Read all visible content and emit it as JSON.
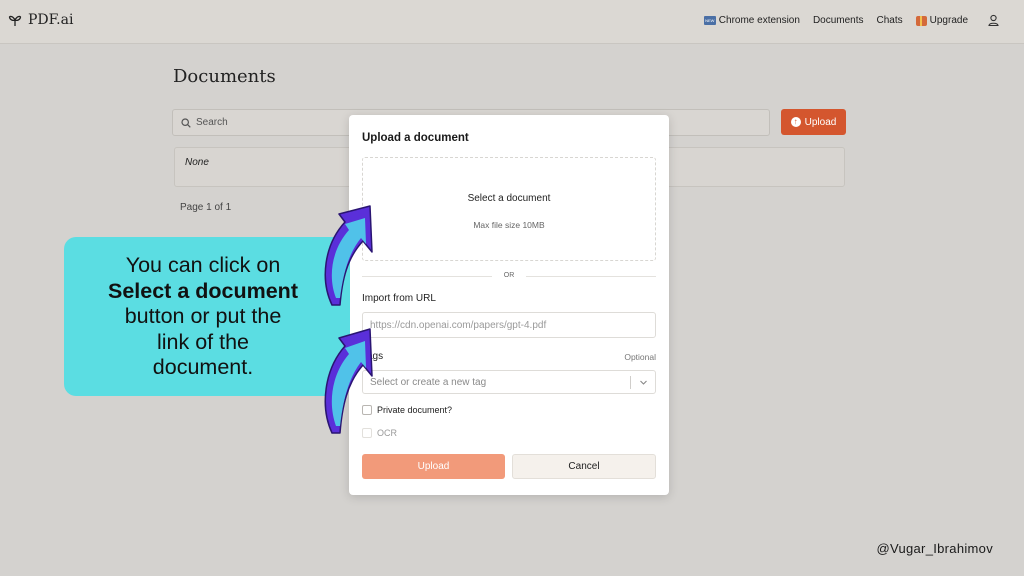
{
  "nav": {
    "brand": "PDF.ai",
    "badge_new": "NEW",
    "links": {
      "chrome_extension": "Chrome extension",
      "documents": "Documents",
      "chats": "Chats",
      "upgrade": "Upgrade"
    }
  },
  "page": {
    "title": "Documents",
    "search_placeholder": "Search",
    "upload_button": "Upload",
    "empty_row": "None",
    "pager": "Page 1 of 1"
  },
  "modal": {
    "title": "Upload a document",
    "dropzone_title": "Select a document",
    "dropzone_sub": "Max file size 10MB",
    "or": "OR",
    "import_label": "Import from URL",
    "url_placeholder": "https://cdn.openai.com/papers/gpt-4.pdf",
    "tags_label": "Tags",
    "optional": "Optional",
    "tag_placeholder": "Select or create a new tag",
    "private_label": "Private document?",
    "ocr_label": "OCR",
    "upload_button": "Upload",
    "cancel_button": "Cancel"
  },
  "annotation": {
    "line1": "You can click on",
    "line2": "Select a document",
    "line3": "button or put the",
    "line4": "link of the",
    "line5": "document."
  },
  "watermark": "@Vugar_Ibrahimov",
  "colors": {
    "accent": "#d4562e",
    "callout": "#5bdde2",
    "arrow": "#5a2fd9",
    "arrow_light": "#4fd3ea"
  }
}
